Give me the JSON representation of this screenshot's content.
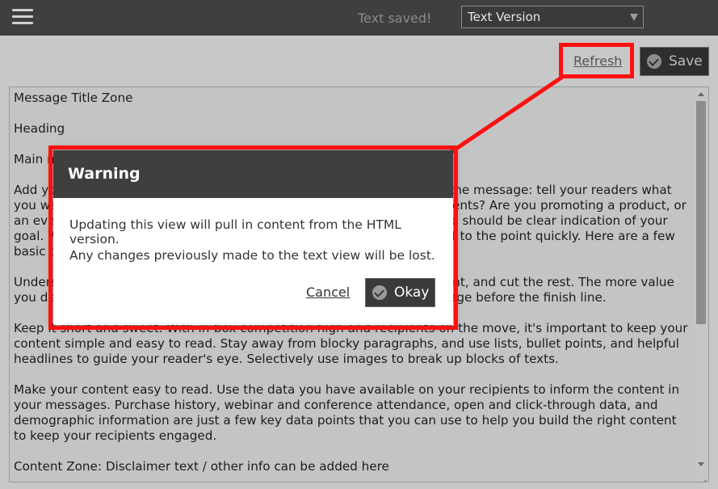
{
  "topbar": {
    "menu_icon": "hamburger-menu-icon",
    "status_text": "Text saved!",
    "version_select": {
      "selected": "Text Version",
      "arrow_icon": "dropdown-arrow-icon"
    }
  },
  "toolbar": {
    "refresh_label": "Refresh",
    "save_label": "Save",
    "save_icon": "check-circle-icon"
  },
  "editor": {
    "paragraphs": [
      "Message Title Zone",
      "Heading",
      "Main message zone",
      "Add your message content here. Use this space to make your case for the message: tell your readers what you want them to know. Are you simply updating them about recent events? Are you promoting a product, or an event you'd like them to register for? Within the first few words there should be clear indication of your goal. With recipients crunched for time or on the move, you need to get to the point quickly. Here are a few basic tips:",
      "Understand what the main points your readers will need to know up front, and cut the rest. The more value you deliver, the more they'll expect to get something out of your message before the finish line.",
      "Keep it short and sweet. With in-box competition high and recipients on the move, it's important to keep your content simple and easy to read. Stay away from blocky paragraphs, and use lists, bullet points, and helpful headlines to guide your reader's eye. Selectively use images to break up blocks of texts.",
      "Make your content easy to read. Use the data you have available on your recipients to inform the content in your messages. Purchase history, webinar and conference attendance, open and click-through data, and demographic information are just a few key data points that you can use to help you build the right content to keep your recipients engaged.",
      "Content Zone: Disclaimer text / other info can be added here"
    ]
  },
  "dialog": {
    "title": "Warning",
    "message_1": "Updating this view will pull in content from the HTML version.",
    "message_2": "Any changes previously made to the text view will be lost.",
    "cancel_label": "Cancel",
    "okay_label": "Okay",
    "okay_icon": "check-circle-icon"
  },
  "colors": {
    "topbar_bg": "#3f3f3f",
    "dialog_header_bg": "#3f3f3f",
    "highlight": "#ff1010",
    "workspace_bg": "#c8c8c8"
  }
}
